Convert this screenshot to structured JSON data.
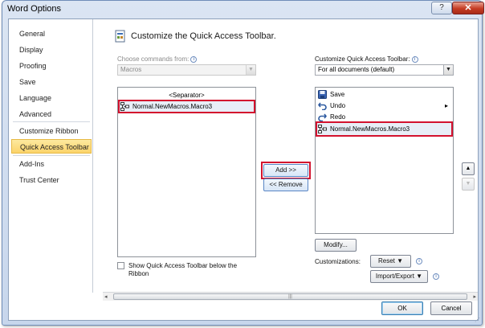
{
  "window": {
    "title": "Word Options",
    "help_label": "?",
    "close_label": "✕"
  },
  "sidebar": {
    "items": [
      {
        "label": "General"
      },
      {
        "label": "Display"
      },
      {
        "label": "Proofing"
      },
      {
        "label": "Save"
      },
      {
        "label": "Language"
      },
      {
        "label": "Advanced"
      },
      {
        "label": "Customize Ribbon"
      },
      {
        "label": "Quick Access Toolbar",
        "selected": true
      },
      {
        "label": "Add-Ins"
      },
      {
        "label": "Trust Center"
      }
    ]
  },
  "main": {
    "header": "Customize the Quick Access Toolbar.",
    "choose_label": "Choose commands from:",
    "choose_value": "Macros",
    "left_list": [
      "<Separator>",
      "Normal.NewMacros.Macro3"
    ],
    "add_button": "Add >>",
    "remove_button": "<< Remove",
    "customize_label": "Customize Quick Access Toolbar:",
    "customize_value": "For all documents (default)",
    "right_list": [
      {
        "label": "Save",
        "icon": "save-icon"
      },
      {
        "label": "Undo",
        "icon": "undo-icon"
      },
      {
        "label": "Redo",
        "icon": "redo-icon"
      },
      {
        "label": "Normal.NewMacros.Macro3",
        "icon": "macro-icon"
      }
    ],
    "modify_button": "Modify...",
    "customizations_label": "Customizations:",
    "reset_button": "Reset ▼",
    "import_export_button": "Import/Export ▼",
    "show_below_label_1": "Show Quick Access Toolbar below the",
    "show_below_label_2": "Ribbon",
    "move_up_glyph": "▲",
    "move_down_glyph": "▼",
    "dropdown_glyph": "▼",
    "submenu_glyph": "▸",
    "info_glyph": "i",
    "scroll_left_glyph": "◂",
    "scroll_right_glyph": "▸",
    "scroll_thumb_glyph": "|||"
  },
  "footer": {
    "ok": "OK",
    "cancel": "Cancel"
  },
  "colors": {
    "highlight_border": "#d3122e",
    "selected_nav": "#fbd36a"
  }
}
